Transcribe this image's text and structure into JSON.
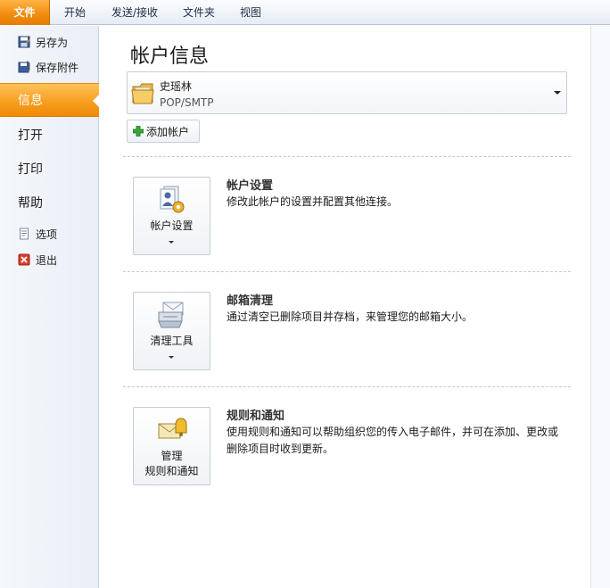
{
  "ribbon": {
    "tabs": [
      "文件",
      "开始",
      "发送/接收",
      "文件夹",
      "视图"
    ]
  },
  "nav": {
    "save_as": "另存为",
    "save_attachments": "保存附件",
    "info": "信息",
    "open": "打开",
    "print": "打印",
    "help": "帮助",
    "options": "选项",
    "exit": "退出"
  },
  "main": {
    "title": "帐户信息",
    "account": {
      "name": "史瑶林",
      "type": "POP/SMTP"
    },
    "add_account_label": "添加帐户",
    "sections": [
      {
        "button_label": "帐户设置",
        "title": "帐户设置",
        "description": "修改此帐户的设置并配置其他连接。"
      },
      {
        "button_label": "清理工具",
        "title": "邮箱清理",
        "description": "通过清空已删除项目并存档，来管理您的邮箱大小。"
      },
      {
        "button_label_line1": "管理",
        "button_label_line2": "规则和通知",
        "title": "规则和通知",
        "description": "使用规则和通知可以帮助组织您的传入电子邮件，并可在添加、更改或删除项目时收到更新。"
      }
    ]
  },
  "colors": {
    "accent_orange": "#f79c1c",
    "ribbon_bg": "#e6ecf5",
    "nav_bg": "#eef2f8"
  }
}
